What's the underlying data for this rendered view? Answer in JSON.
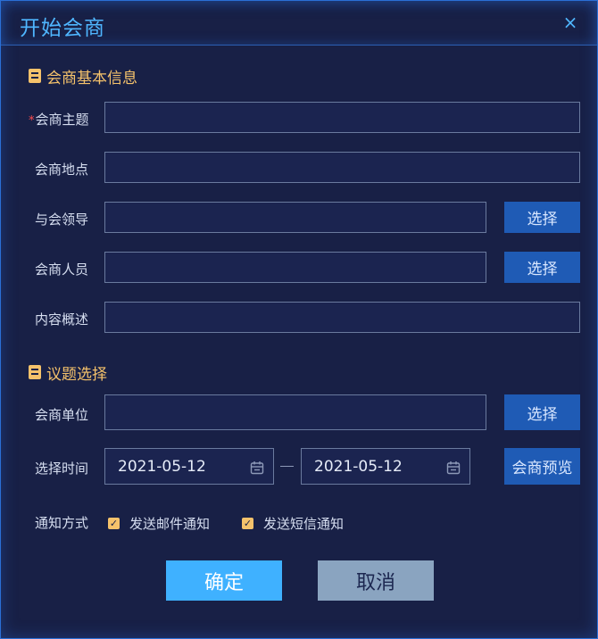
{
  "dialog": {
    "title": "开始会商",
    "close_icon": "close-icon",
    "close_glyph": "×"
  },
  "sections": {
    "basic_info": "会商基本信息",
    "topic_select": "议题选择"
  },
  "fields": {
    "required_mark": "*",
    "subject_label": "会商主题",
    "location_label": "会商地点",
    "leaders_label": "与会领导",
    "personnel_label": "会商人员",
    "summary_label": "内容概述",
    "unit_label": "会商单位",
    "time_label": "选择时间",
    "notify_label": "通知方式"
  },
  "values": {
    "subject": "",
    "location": "",
    "leaders": "",
    "personnel": "",
    "summary": "",
    "unit": ""
  },
  "buttons": {
    "select": "选择",
    "preview": "会商预览",
    "ok": "确定",
    "cancel": "取消"
  },
  "dates": {
    "start": "2021-05-12",
    "end": "2021-05-12"
  },
  "notify": {
    "email": {
      "label": "发送邮件通知",
      "checked": true
    },
    "sms": {
      "label": "发送短信通知",
      "checked": true
    },
    "check_glyph": "✓"
  },
  "colors": {
    "accent": "#4fb6ff",
    "section": "#f5c26b",
    "button_primary": "#3fb1ff",
    "button_select": "#1f5bb5",
    "button_cancel": "#8aa4c0",
    "required": "#ff4d4f"
  }
}
